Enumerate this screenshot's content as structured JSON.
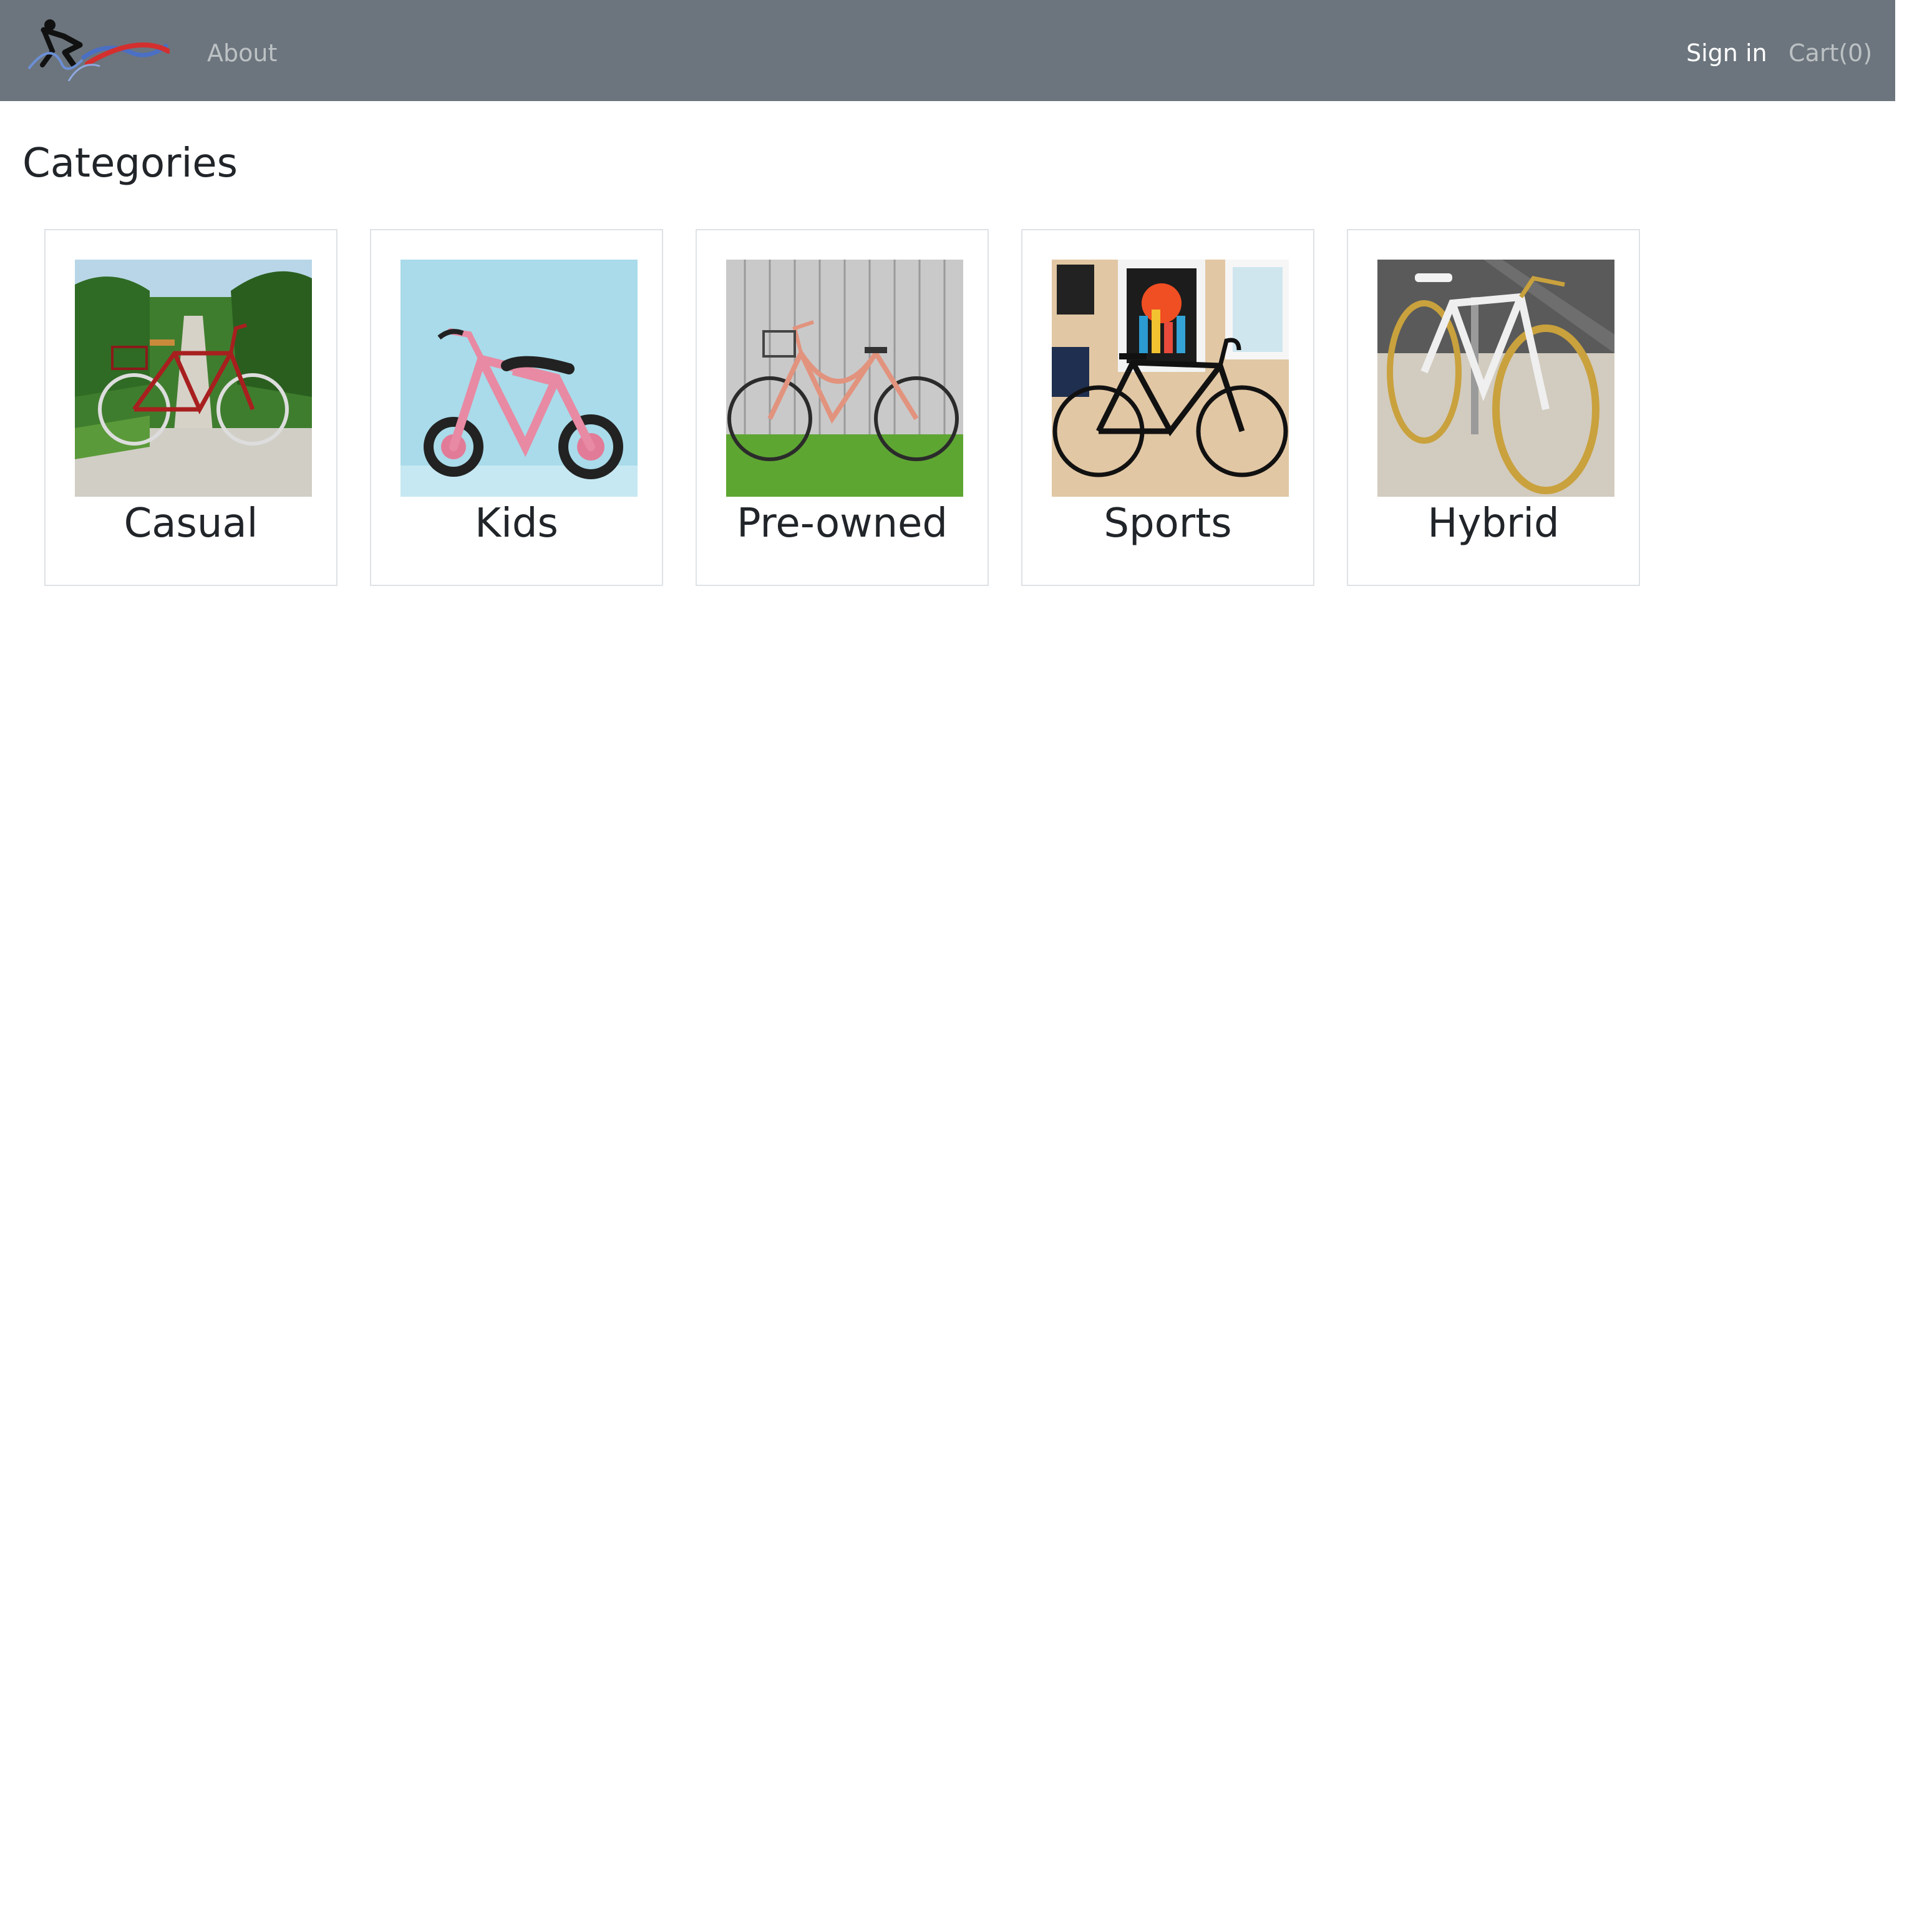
{
  "navbar": {
    "logo_icon": "cyclist-logo-icon",
    "about_label": "About",
    "signin_label": "Sign in",
    "cart_label": "Cart(0)"
  },
  "main": {
    "title": "Categories",
    "categories": [
      {
        "label": "Casual",
        "image": "red-bicycle-on-gravel-path"
      },
      {
        "label": "Kids",
        "image": "pink-kids-bicycle"
      },
      {
        "label": "Pre-owned",
        "image": "peach-vintage-bicycle-with-basket"
      },
      {
        "label": "Sports",
        "image": "black-road-bicycle-against-wall"
      },
      {
        "label": "Hybrid",
        "image": "white-gold-fixie-bicycle"
      }
    ]
  },
  "colors": {
    "navbar_bg": "#6c757d",
    "nav_link_muted": "rgba(255,255,255,0.55)",
    "nav_link_active": "#ffffff",
    "card_border": "#dee2e6"
  }
}
